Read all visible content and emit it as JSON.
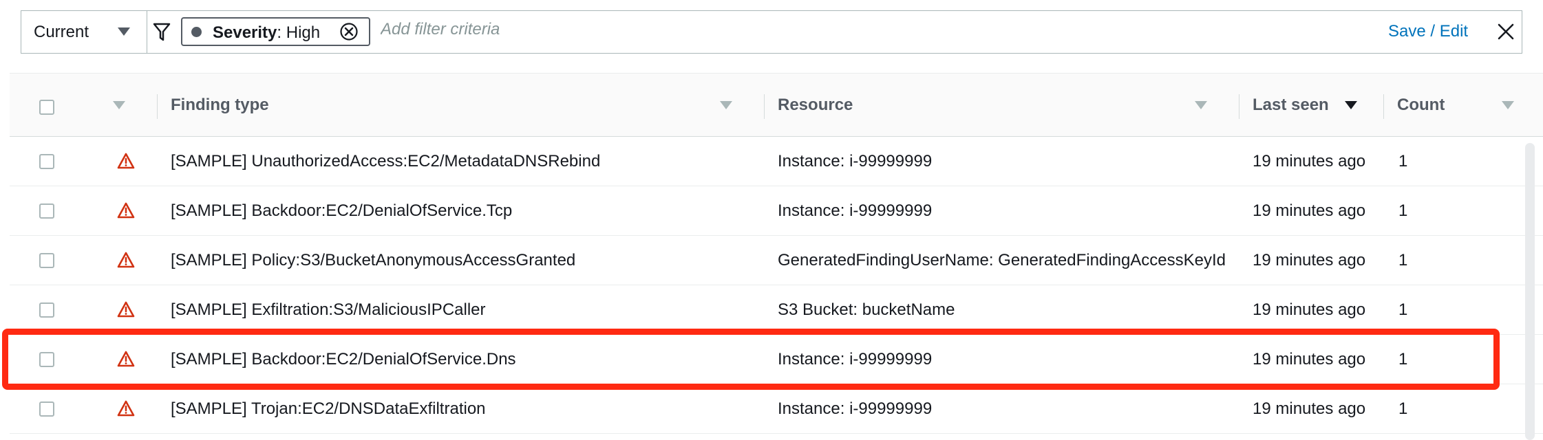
{
  "filter_bar": {
    "view_select": {
      "value": "Current"
    },
    "token": {
      "key": "Severity",
      "separator": ": ",
      "value": "High"
    },
    "input_placeholder": "Add filter criteria",
    "save_edit_label": "Save / Edit"
  },
  "table": {
    "columns": [
      "Finding type",
      "Resource",
      "Last seen",
      "Count"
    ],
    "rows": [
      {
        "finding_type": "[SAMPLE] UnauthorizedAccess:EC2/MetadataDNSRebind",
        "resource": "Instance: i-99999999",
        "last_seen": "19 minutes ago",
        "count": "1"
      },
      {
        "finding_type": "[SAMPLE] Backdoor:EC2/DenialOfService.Tcp",
        "resource": "Instance: i-99999999",
        "last_seen": "19 minutes ago",
        "count": "1"
      },
      {
        "finding_type": "[SAMPLE] Policy:S3/BucketAnonymousAccessGranted",
        "resource": "GeneratedFindingUserName: GeneratedFindingAccessKeyId",
        "last_seen": "19 minutes ago",
        "count": "1"
      },
      {
        "finding_type": "[SAMPLE] Exfiltration:S3/MaliciousIPCaller",
        "resource": "S3 Bucket: bucketName",
        "last_seen": "19 minutes ago",
        "count": "1"
      },
      {
        "finding_type": "[SAMPLE] Backdoor:EC2/DenialOfService.Dns",
        "resource": "Instance: i-99999999",
        "last_seen": "19 minutes ago",
        "count": "1"
      },
      {
        "finding_type": "[SAMPLE] Trojan:EC2/DNSDataExfiltration",
        "resource": "Instance: i-99999999",
        "last_seen": "19 minutes ago",
        "count": "1"
      }
    ]
  },
  "colors": {
    "severity_high": "#d13212",
    "link": "#0073bb",
    "highlight": "#ff2a12"
  },
  "icons": [
    "caret-down-icon",
    "filter-icon",
    "remove-token-icon",
    "close-icon",
    "warning-triangle-icon",
    "sort-caret-icon"
  ]
}
